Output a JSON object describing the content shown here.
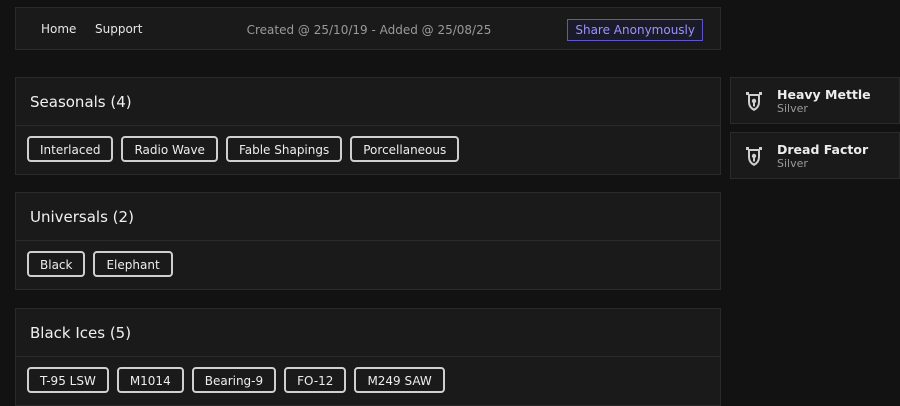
{
  "nav": {
    "home": "Home",
    "support": "Support",
    "meta": "Created @ 25/10/19 - Added @ 25/08/25",
    "share": "Share Anonymously"
  },
  "sections": [
    {
      "title": "Seasonals (4)",
      "items": [
        "Interlaced",
        "Radio Wave",
        "Fable Shapings",
        "Porcellaneous"
      ]
    },
    {
      "title": "Universals (2)",
      "items": [
        "Black",
        "Elephant"
      ]
    },
    {
      "title": "Black Ices (5)",
      "items": [
        "T-95 LSW",
        "M1014",
        "Bearing-9",
        "FO-12",
        "M249 SAW"
      ]
    }
  ],
  "badges": [
    {
      "name": "Heavy Mettle",
      "tier": "Silver",
      "icon": "shield-emblem-icon"
    },
    {
      "name": "Dread Factor",
      "tier": "Silver",
      "icon": "shield-emblem-icon"
    }
  ],
  "colors": {
    "background": "#121212",
    "panel": "#1a1a1a",
    "accent": "#5d55c8",
    "accent_text": "#9c93ff"
  }
}
